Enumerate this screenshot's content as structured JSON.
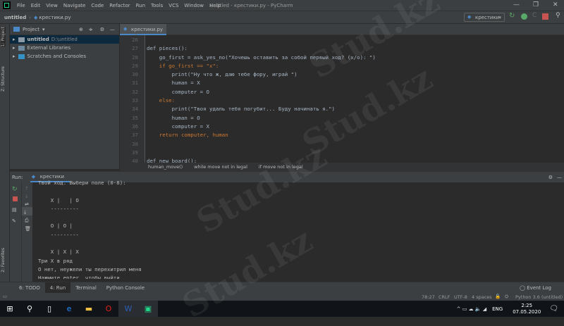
{
  "menubar": {
    "items": [
      "File",
      "Edit",
      "View",
      "Navigate",
      "Code",
      "Refactor",
      "Run",
      "Tools",
      "VCS",
      "Window",
      "Help"
    ],
    "title": "untitled - крестики.py - PyCharm"
  },
  "navbar": {
    "project": "untitled",
    "file": "крестики.py",
    "run_config": "крестики"
  },
  "left_strip": {
    "project_tab": "1: Project",
    "structure_tab": "Z: Structure",
    "favorites_tab": "2: Favorites"
  },
  "project": {
    "title": "Project",
    "items": [
      {
        "name": "untitled",
        "path": "D:\\untitled"
      },
      {
        "name": "External Libraries"
      },
      {
        "name": "Scratches and Consoles"
      }
    ]
  },
  "editor": {
    "tab": "крестики.py",
    "lines": [
      {
        "n": "26",
        "code": ""
      },
      {
        "n": "27",
        "code": "def pieces():"
      },
      {
        "n": "28",
        "code": "    go_first = ask_yes_no(\"Хочешь оставить за собой первый ход? (x/o): \")"
      },
      {
        "n": "29",
        "code": "    if go_first == \"x\":"
      },
      {
        "n": "30",
        "code": "        print(\"Ну что ж, даю тебе фору, играй \")"
      },
      {
        "n": "31",
        "code": "        human = X"
      },
      {
        "n": "32",
        "code": "        computer = O"
      },
      {
        "n": "33",
        "code": "    else:"
      },
      {
        "n": "34",
        "code": "        print(\"Твоя удаль тебя погубит... Буду начинать я.\")"
      },
      {
        "n": "35",
        "code": "        human = O"
      },
      {
        "n": "36",
        "code": "        computer = X"
      },
      {
        "n": "37",
        "code": "    return computer, human"
      },
      {
        "n": "38",
        "code": ""
      },
      {
        "n": "39",
        "code": ""
      },
      {
        "n": "40",
        "code": "def new_board():"
      }
    ],
    "breadcrumbs": [
      "human_move()",
      "while move not in legal",
      "if move not in legal"
    ]
  },
  "run": {
    "label": "Run:",
    "tab": "крестики",
    "console": [
      "Твой ход. Выбери поле (0-8):",
      "",
      "    X |   | O",
      "    ---------",
      "",
      "    O | O |",
      "    ---------",
      "",
      "    X | X | X",
      "Три X в ряд",
      "О нет, неужели ты перехитрил меня",
      "Нажмите enter, чтобы выйти"
    ]
  },
  "bottom_tabs": [
    "6: TODO",
    "4: Run",
    "Terminal",
    "Python Console"
  ],
  "status": {
    "event_log": "Event Log",
    "position": "78:27",
    "line_sep": "CRLF",
    "encoding": "UTF-8",
    "indent": "4 spaces",
    "interpreter": "Python 3.6 (untitled)"
  },
  "taskbar": {
    "lang": "ENG",
    "time": "2:25",
    "date": "07.05.2020"
  },
  "watermark": "Stud.kz - Stud.kz"
}
